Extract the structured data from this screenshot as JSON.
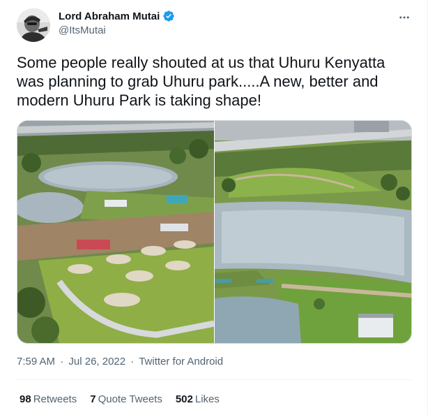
{
  "author": {
    "display_name": "Lord Abraham Mutai",
    "handle": "@ItsMutai",
    "verified": true
  },
  "icons": {
    "verified": "verified-badge-icon",
    "more": "more-horizontal-icon"
  },
  "tweet": {
    "text": "Some people really shouted at us that Uhuru Kenyatta was planning to grab Uhuru park.....A new, better and modern Uhuru Park is taking shape!"
  },
  "meta": {
    "time": "7:59 AM",
    "separator": "·",
    "date": "Jul 26, 2022",
    "source": "Twitter for Android"
  },
  "stats": [
    {
      "count": "98",
      "label": "Retweets"
    },
    {
      "count": "7",
      "label": "Quote Tweets"
    },
    {
      "count": "502",
      "label": "Likes"
    }
  ],
  "colors": {
    "text_primary": "#0f1419",
    "text_secondary": "#536471",
    "verified_blue": "#1d9bf0",
    "divider": "#eff3f4"
  }
}
